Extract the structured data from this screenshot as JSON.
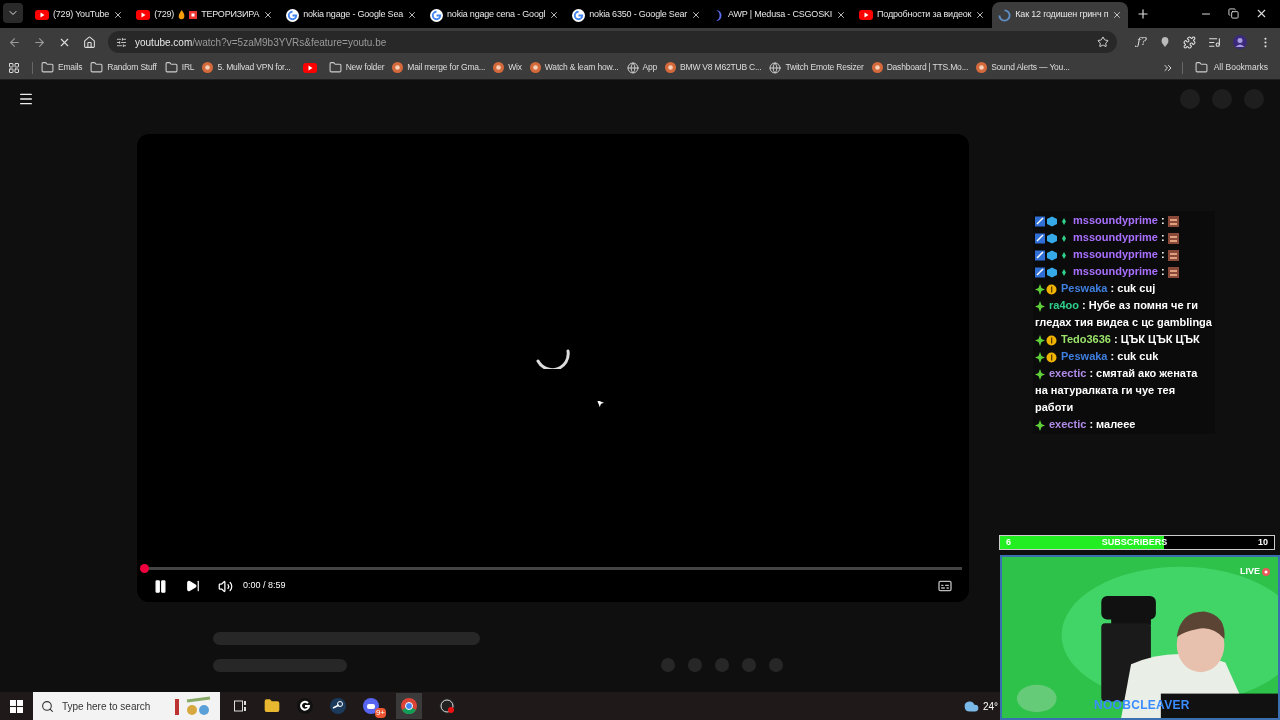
{
  "tabs": [
    {
      "kind": "youtube",
      "title": "(729) YouTube",
      "selected": false
    },
    {
      "kind": "youtube",
      "title": "(729)",
      "title_2": "ТЕРОРИЗИРА",
      "selected": false
    },
    {
      "kind": "google",
      "title": "nokia ngage - Google Sea",
      "selected": false
    },
    {
      "kind": "google",
      "title": "nokia ngage cena - Googl",
      "selected": false
    },
    {
      "kind": "google",
      "title": "nokia 6350 - Google Sear",
      "selected": false
    },
    {
      "kind": "moon",
      "title": "AWP | Medusa - CSGOSKI",
      "selected": false
    },
    {
      "kind": "youtube",
      "title": "Подробности за видеок",
      "selected": false
    },
    {
      "kind": "loading",
      "title": "Как 12 годишен гринч п",
      "selected": true
    }
  ],
  "toolbar_glyph": "ƒ?",
  "address": {
    "host": "youtube.com",
    "path": "/watch?v=5zaM9b3YVRs&feature=youtu.be"
  },
  "bookmarks": [
    {
      "kind": "folder",
      "label": "Emails"
    },
    {
      "kind": "folder",
      "label": "Random Stuff"
    },
    {
      "kind": "folder",
      "label": "IRL"
    },
    {
      "kind": "site",
      "label": "5. Mullvad VPN for..."
    },
    {
      "kind": "youtube"
    },
    {
      "kind": "folder",
      "label": "New folder"
    },
    {
      "kind": "site",
      "label": "Mail merge for Gma..."
    },
    {
      "kind": "site",
      "label": "Wix"
    },
    {
      "kind": "site",
      "label": "Watch & learn how..."
    },
    {
      "kind": "globe",
      "label": "App"
    },
    {
      "kind": "site",
      "label": "BMW V8 M62TUB C..."
    },
    {
      "kind": "globe",
      "label": "Twitch Emote Resizer"
    },
    {
      "kind": "site",
      "label": "Dashboard | TTS.Mo..."
    },
    {
      "kind": "site",
      "label": "Sound Alerts — You..."
    }
  ],
  "all_bookmarks": "All Bookmarks",
  "player": {
    "time": "0:00 / 8:59",
    "playing": true,
    "level": 0.0
  },
  "chat": [
    {
      "kind": "emote",
      "user": "mssoundyprime",
      "sep": ":",
      "color": "#a970ff"
    },
    {
      "kind": "emote",
      "user": "mssoundyprime",
      "sep": ":",
      "color": "#a970ff"
    },
    {
      "kind": "emote",
      "user": "mssoundyprime",
      "sep": ":",
      "color": "#a970ff"
    },
    {
      "kind": "emote",
      "user": "mssoundyprime",
      "sep": ":",
      "color": "#a970ff"
    },
    {
      "kind": "text",
      "user": "Peswaka",
      "sep": ":",
      "color": "#3f7fe0",
      "coin": true,
      "text": "cuk cuj"
    },
    {
      "kind": "text",
      "user": "ra4oo",
      "sep": ":",
      "color": "#2fd08a",
      "coin": false,
      "text": "Нубе аз помня че ги гледах тия видеа с цс gamblinga"
    },
    {
      "kind": "text",
      "user": "Tedo3636",
      "sep": ":",
      "color": "#9be36a",
      "coin": true,
      "text": "ЦЪК ЦЪК ЦЪК"
    },
    {
      "kind": "text",
      "user": "Peswaka",
      "sep": ":",
      "color": "#3f7fe0",
      "coin": true,
      "text": "cuk cuk"
    },
    {
      "kind": "text",
      "user": "exectic",
      "sep": ":",
      "color": "#b08be8",
      "coin": false,
      "text": "смятай ако жената на натуралката ги чуе тея работи"
    },
    {
      "kind": "text",
      "user": "exectic",
      "sep": ":",
      "color": "#b08be8",
      "coin": false,
      "text": "малеее"
    }
  ],
  "subscribers": {
    "current": "6",
    "label": "SUBSCRIBERS",
    "goal": "10",
    "level": 0.6
  },
  "webcam": {
    "live": "LIVE",
    "name": "NOOBCLEAVER"
  },
  "taskbar": {
    "search_placeholder": "Type here to search",
    "discord_badge": "9+",
    "temperature": "24°"
  }
}
